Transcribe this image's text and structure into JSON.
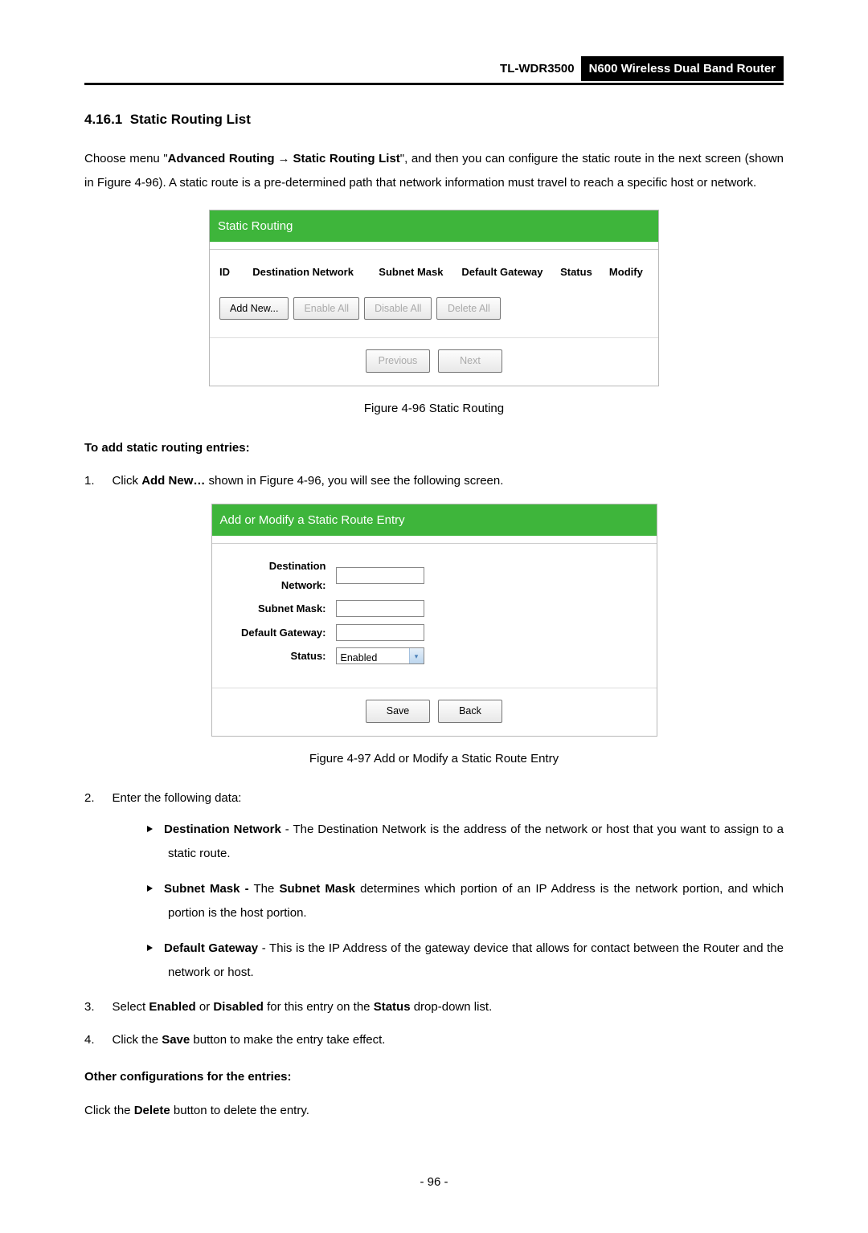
{
  "header": {
    "model": "TL-WDR3500",
    "product": "N600 Wireless Dual Band Router"
  },
  "section": {
    "number": "4.16.1",
    "title": "Static Routing List"
  },
  "intro": {
    "pre": "Choose menu \"",
    "b1": "Advanced Routing",
    "b2": "Static Routing List",
    "post": "\", and then you can configure the static route in the next screen (shown in Figure 4-96). A static route is a pre-determined path that network information must travel to reach a specific host or network."
  },
  "fig1": {
    "title": "Static Routing",
    "cols": {
      "id": "ID",
      "dest": "Destination Network",
      "mask": "Subnet Mask",
      "gw": "Default Gateway",
      "status": "Status",
      "modify": "Modify"
    },
    "buttons": {
      "add": "Add New...",
      "enable": "Enable All",
      "disable": "Disable All",
      "delete": "Delete All",
      "prev": "Previous",
      "next": "Next"
    },
    "caption": "Figure 4-96 Static Routing"
  },
  "addHeading": "To add static routing entries:",
  "step1": {
    "pre": "Click ",
    "bold": "Add New…",
    "post": " shown in Figure 4-96, you will see the following screen."
  },
  "fig2": {
    "title": "Add or Modify a Static Route Entry",
    "labels": {
      "dest": "Destination Network:",
      "mask": "Subnet Mask:",
      "gw": "Default Gateway:",
      "status": "Status:"
    },
    "statusValue": "Enabled",
    "buttons": {
      "save": "Save",
      "back": "Back"
    },
    "caption": "Figure 4-97 Add or Modify a Static Route Entry"
  },
  "step2": {
    "intro": "Enter the following data:",
    "bullets": {
      "dest": {
        "b": "Destination Network",
        "t": " - The Destination Network is the address of the network or host that you want to assign to a static route."
      },
      "mask": {
        "b": "Subnet Mask -",
        "t1": " The ",
        "b2": "Subnet Mask",
        "t2": " determines which portion of an IP Address is the network portion, and which portion is the host portion."
      },
      "gw": {
        "b": "Default Gateway",
        "t": " - This is the IP Address of the gateway device that allows for contact between the Router and the network or host."
      }
    }
  },
  "step3": {
    "pre": "Select ",
    "b1": "Enabled",
    "mid": " or ",
    "b2": "Disabled",
    "mid2": " for this entry on the ",
    "b3": "Status",
    "post": " drop-down list."
  },
  "step4": {
    "pre": "Click the ",
    "b": "Save",
    "post": " button to make the entry take effect."
  },
  "otherHeading": "Other configurations for the entries:",
  "otherText": {
    "pre": "Click the ",
    "b": "Delete",
    "post": " button to delete the entry."
  },
  "pageNum": "- 96 -"
}
